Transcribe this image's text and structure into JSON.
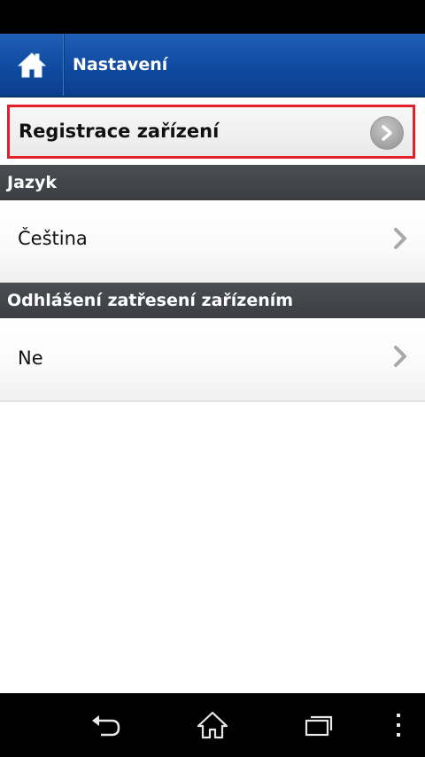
{
  "header": {
    "title": "Nastavení"
  },
  "registration": {
    "label": "Registrace zařízení"
  },
  "sections": [
    {
      "title": "Jazyk",
      "value": "Čeština"
    },
    {
      "title": "Odhlášení zatřesení zařízením",
      "value": "Ne"
    }
  ],
  "colors": {
    "header_blue": "#0f4aa0",
    "highlight_red": "#e2202a",
    "section_dark": "#3f4246"
  }
}
